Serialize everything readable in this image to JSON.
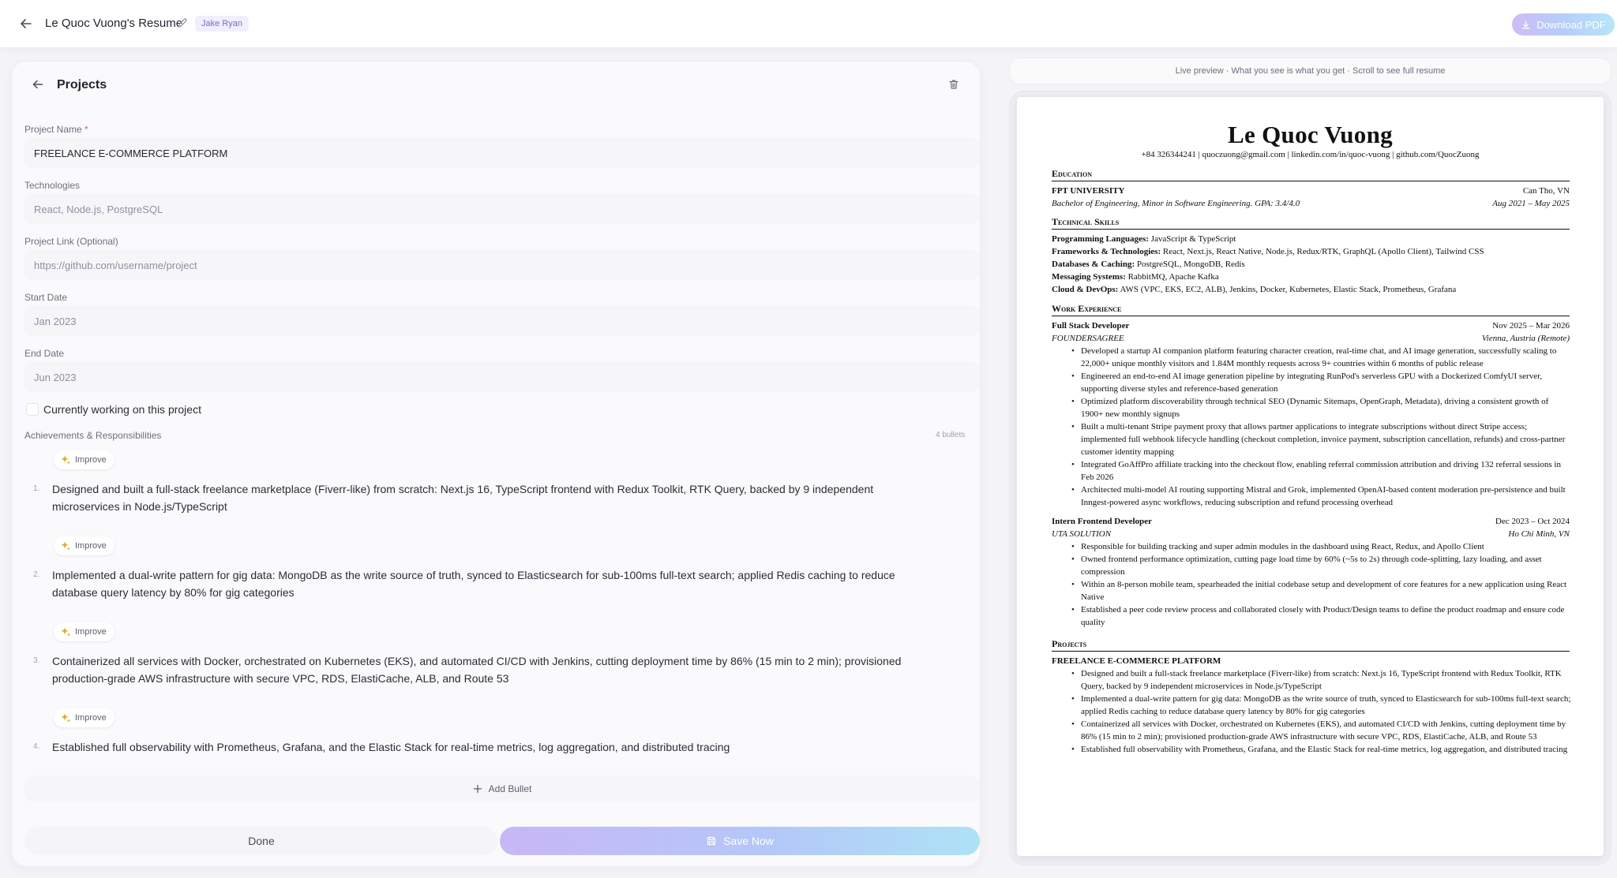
{
  "header": {
    "title": "Le Quoc Vuong's Resume",
    "template_badge": "Jake Ryan",
    "download_label": "Download PDF"
  },
  "editor": {
    "section_title": "Projects",
    "fields": {
      "project_name_label": "Project Name",
      "project_name_required": "*",
      "project_name_value": "FREELANCE E-COMMERCE PLATFORM",
      "technologies_label": "Technologies",
      "technologies_placeholder": "React, Node.js, PostgreSQL",
      "link_label": "Project Link (Optional)",
      "link_placeholder": "https://github.com/username/project",
      "start_label": "Start Date",
      "start_placeholder": "Jan 2023",
      "end_label": "End Date",
      "end_placeholder": "Jun 2023"
    },
    "currently_working_label": "Currently working on this project",
    "achievements_label": "Achievements & Responsibilities",
    "bullet_count": "4 bullets",
    "improve_label": "Improve",
    "bullets": [
      {
        "num": "1.",
        "text": "Designed and built a full-stack freelance marketplace (Fiverr-like) from scratch: Next.js 16, TypeScript frontend with Redux Toolkit, RTK Query, backed by 9 independent microservices in Node.js/TypeScript"
      },
      {
        "num": "2.",
        "text": "Implemented a dual-write pattern for gig data: MongoDB as the write source of truth, synced to Elasticsearch for sub-100ms full-text search; applied Redis caching to reduce database query latency by 80% for gig categories"
      },
      {
        "num": "3.",
        "text": "Containerized all services with Docker, orchestrated on Kubernetes (EKS), and automated CI/CD with Jenkins, cutting deployment time by 86% (15 min to 2 min); provisioned production-grade AWS infrastructure with secure VPC, RDS, ElastiCache, ALB, and Route 53"
      },
      {
        "num": "4.",
        "text": "Established full observability with Prometheus, Grafana, and the Elastic Stack for real-time metrics, log aggregation, and distributed tracing"
      }
    ],
    "add_bullet_label": "Add Bullet",
    "done_label": "Done",
    "save_label": "Save Now"
  },
  "preview": {
    "note": "Live preview · What you see is what you get · Scroll to see full resume",
    "name": "Le Quoc Vuong",
    "contact": "+84 326344241 | quoczuong@gmail.com | linkedin.com/in/quoc-vuong | github.com/QuocZuong",
    "education_heading": "Education",
    "school": "FPT UNIVERSITY",
    "school_location": "Can Tho, VN",
    "degree": "Bachelor of Engineering, Minor in Software Engineering. GPA: 3.4/4.0",
    "degree_dates": "Aug 2021 – May 2025",
    "skills_heading": "Technical Skills",
    "skills": [
      {
        "label": "Programming Languages:",
        "value": " JavaScript & TypeScript"
      },
      {
        "label": "Frameworks & Technologies:",
        "value": " React, Next.js, React Native, Node.js, Redux/RTK, GraphQL (Apollo Client), Tailwind CSS"
      },
      {
        "label": "Databases & Caching:",
        "value": " PostgreSQL, MongoDB, Redis"
      },
      {
        "label": "Messaging Systems:",
        "value": " RabbitMQ, Apache Kafka"
      },
      {
        "label": "Cloud & DevOps:",
        "value": " AWS (VPC, EKS, EC2, ALB), Jenkins, Docker, Kubernetes, Elastic Stack, Prometheus, Grafana"
      }
    ],
    "work_heading": "Work Experience",
    "jobs": [
      {
        "role": "Full Stack Developer",
        "dates": "Nov 2025 – Mar 2026",
        "company": "FOUNDERSAGREE",
        "location": "Vienna, Austria (Remote)",
        "bullets": [
          "Developed a startup AI companion platform featuring character creation, real-time chat, and AI image generation, successfully scaling to 22,000+ unique monthly visitors and 1.84M monthly requests across 9+ countries within 6 months of public release",
          "Engineered an end-to-end AI image generation pipeline by integrating RunPod's serverless GPU with a Dockerized ComfyUI server, supporting diverse styles and reference-based generation",
          "Optimized platform discoverability through technical SEO (Dynamic Sitemaps, OpenGraph, Metadata), driving a consistent growth of 1900+ new monthly signups",
          "Built a multi-tenant Stripe payment proxy that allows partner applications to integrate subscriptions without direct Stripe access; implemented full webhook lifecycle handling (checkout completion, invoice payment, subscription cancellation, refunds) and cross-partner customer identity mapping",
          "Integrated GoAffPro affiliate tracking into the checkout flow, enabling referral commission attribution and driving 132 referral sessions in Feb 2026",
          "Architected multi-model AI routing supporting Mistral and Grok, implemented OpenAI-based content moderation pre-persistence and built Inngest-powered async workflows, reducing subscription and refund processing overhead"
        ]
      },
      {
        "role": "Intern Frontend Developer",
        "dates": "Dec 2023 – Oct 2024",
        "company": "UTA SOLUTION",
        "location": "Ho Chi Minh, VN",
        "bullets": [
          "Responsible for building tracking and super admin modules in the dashboard using React, Redux, and Apollo Client",
          "Owned frontend performance optimization, cutting page load time by 60% (~5s to 2s) through code-splitting, lazy loading, and asset compression",
          "Within an 8-person mobile team, spearheaded the initial codebase setup and development of core features for a new application using React Native",
          "Established a peer code review process and collaborated closely with Product/Design teams to define the product roadmap and ensure code quality"
        ]
      }
    ],
    "projects_heading": "Projects",
    "project_title": "FREELANCE E-COMMERCE PLATFORM",
    "project_bullets": [
      "Designed and built a full-stack freelance marketplace (Fiverr-like) from scratch: Next.js 16, TypeScript frontend with Redux Toolkit, RTK Query, backed by 9 independent microservices in Node.js/TypeScript",
      "Implemented a dual-write pattern for gig data: MongoDB as the write source of truth, synced to Elasticsearch for sub-100ms full-text search; applied Redis caching to reduce database query latency by 80% for gig categories",
      "Containerized all services with Docker, orchestrated on Kubernetes (EKS), and automated CI/CD with Jenkins, cutting deployment time by 86% (15 min to 2 min); provisioned production-grade AWS infrastructure with secure VPC, RDS, ElastiCache, ALB, and Route 53",
      "Established full observability with Prometheus, Grafana, and the Elastic Stack for real-time metrics, log aggregation, and distributed tracing"
    ]
  },
  "icons": {
    "back": "arrow-left-icon",
    "edit": "pencil-icon",
    "download": "download-icon",
    "delete": "trash-icon",
    "improve": "sparkle-icon",
    "add": "plus-icon",
    "save": "floppy-icon"
  },
  "colors": {
    "accent": "#7c68d6",
    "improve_icon": "#f2a21a",
    "required": "#e2557a"
  }
}
